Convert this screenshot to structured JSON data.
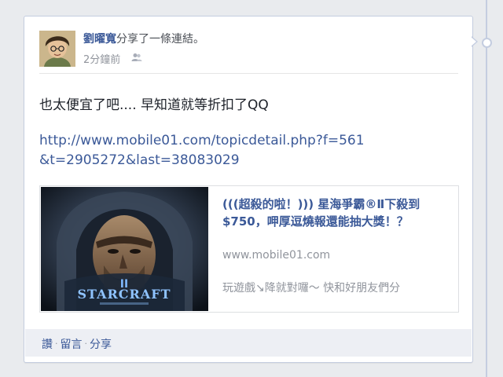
{
  "post": {
    "author_name": "劉曜寬",
    "action_text": "分享了一條連結。",
    "timestamp": "2分鐘前",
    "audience_icon": "friends-icon",
    "status_text": "也太便宜了吧.... 早知道就等折扣了QQ",
    "shared_url": "http://www.mobile01.com/topicdetail.php?f=561&t=2905272&last=38083029"
  },
  "link_preview": {
    "title": "(((超殺的啦！))) 星海爭霸®Ⅱ下殺到$750，呷厚逗燒報還能抽大獎！？",
    "domain": "www.mobile01.com",
    "description": "玩遊戲↘降就對囉～ 快和好朋友們分",
    "image_logo_text": "STARCRAFT"
  },
  "actions": {
    "like": "讚",
    "comment": "留言",
    "share": "分享",
    "separator": "·"
  },
  "colors": {
    "link": "#3b5998",
    "meta": "#90949c",
    "footer_bg": "#edeff4",
    "page_bg": "#e9ebee"
  }
}
